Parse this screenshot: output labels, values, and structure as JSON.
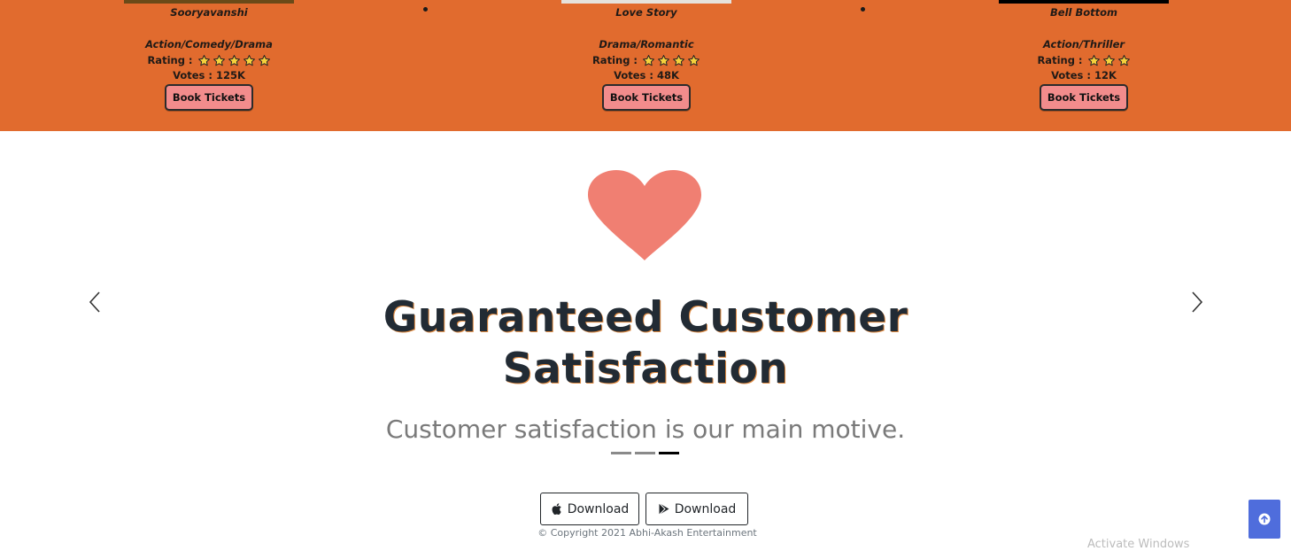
{
  "movies": [
    {
      "title": "Sooryavanshi",
      "genre": "Action/Comedy/Drama",
      "rating_label": "Rating :",
      "rating": 5,
      "votes": "Votes : 125K",
      "book_label": "Book Tickets"
    },
    {
      "title": "Love Story",
      "genre": "Drama/Romantic",
      "rating_label": "Rating :",
      "rating": 4,
      "votes": "Votes : 48K",
      "book_label": "Book Tickets"
    },
    {
      "title": "Bell Bottom",
      "genre": "Action/Thriller",
      "rating_label": "Rating :",
      "rating": 3,
      "votes": "Votes : 12K",
      "book_label": "Book Tickets"
    }
  ],
  "carousel": {
    "heading_line1": "Guaranteed Customer",
    "heading_line2": "Satisfaction",
    "subtitle": "Customer satisfaction is our main motive.",
    "slide_count": 3,
    "active_slide": 3,
    "icon": "heart-icon"
  },
  "downloads": {
    "apple_label": "Download",
    "play_label": "Download"
  },
  "footer": {
    "copyright": "© Copyright 2021 Abhi-Akash Entertainment"
  },
  "overlay": {
    "watermark": "Activate Windows"
  },
  "colors": {
    "band": "#e16b2e",
    "book_button": "#f28c8c",
    "heart": "#f07f72",
    "scroll_top": "#4f6ddc"
  }
}
